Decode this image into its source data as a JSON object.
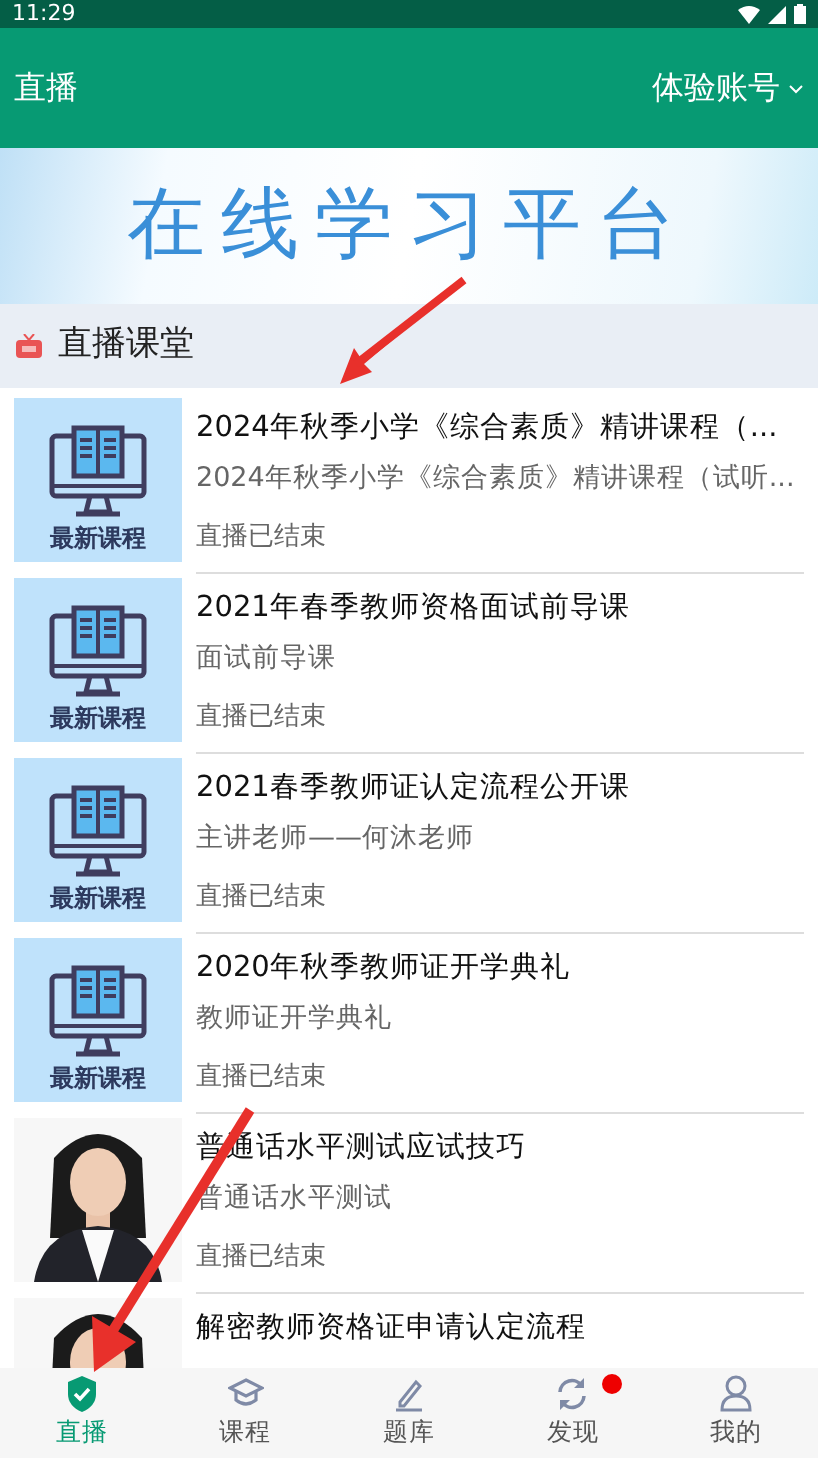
{
  "status_bar": {
    "time": "11:29"
  },
  "header": {
    "title": "直播",
    "account": "体验账号"
  },
  "banner": {
    "title": "在线学习平台"
  },
  "section": {
    "title": "直播课堂"
  },
  "courses": [
    {
      "kind": "course",
      "thumb_label": "最新课程",
      "title": "2024年秋季小学《综合素质》精讲课程（...",
      "subtitle": "2024年秋季小学《综合素质》精讲课程（试听...",
      "status": "直播已结束"
    },
    {
      "kind": "course",
      "thumb_label": "最新课程",
      "title": "2021年春季教师资格面试前导课",
      "subtitle": "面试前导课",
      "status": "直播已结束"
    },
    {
      "kind": "course",
      "thumb_label": "最新课程",
      "title": "2021春季教师证认定流程公开课",
      "subtitle": "主讲老师——何沐老师",
      "status": "直播已结束"
    },
    {
      "kind": "course",
      "thumb_label": "最新课程",
      "title": "2020年秋季教师证开学典礼",
      "subtitle": "教师证开学典礼",
      "status": "直播已结束"
    },
    {
      "title": "普通话水平测试应试技巧",
      "subtitle": "普通话水平测试",
      "status": "直播已结束"
    },
    {
      "title": "解密教师资格证申请认定流程"
    }
  ],
  "tabs": [
    {
      "label": "直播",
      "selected": true,
      "dot": false
    },
    {
      "label": "课程",
      "selected": false,
      "dot": false
    },
    {
      "label": "题库",
      "selected": false,
      "dot": false
    },
    {
      "label": "发现",
      "selected": false,
      "dot": true
    },
    {
      "label": "我的",
      "selected": false,
      "dot": false
    }
  ]
}
